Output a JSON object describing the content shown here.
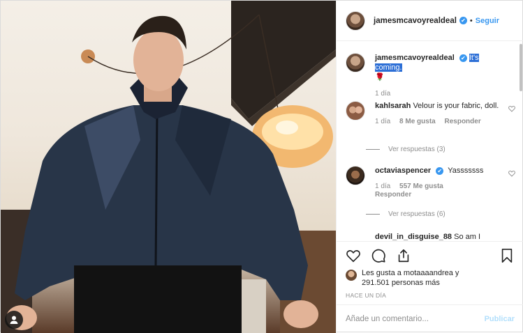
{
  "post": {
    "author": {
      "username": "jamesmcavoyrealdeal",
      "verified_icon": "✔",
      "separator": "•",
      "follow_label": "Seguir"
    },
    "caption": {
      "username": "jamesmcavoyrealdeal",
      "text": "It's coming.",
      "emoji": "🌹",
      "time": "1 día"
    },
    "comments": [
      {
        "username": "kahlsarah",
        "text": "Velour is your fabric, doll.",
        "time": "1 día",
        "likes": "8 Me gusta",
        "reply_label": "Responder",
        "view_replies": "Ver respuestas (3)"
      },
      {
        "username": "octaviaspencer",
        "text": "Yasssssss",
        "time": "1 día",
        "likes": "557 Me gusta",
        "reply_label": "Responder",
        "view_replies": "Ver respuestas (6)"
      },
      {
        "username": "devil_in_disguise_88",
        "text": "So am I"
      }
    ],
    "likes": {
      "line1": "Les gusta a motaaaandrea y",
      "line2": "291.501 personas más"
    },
    "timestamp": "HACE UN DÍA",
    "add_comment": {
      "placeholder": "Añade un comentario...",
      "publish_label": "Publicar"
    }
  },
  "colors": {
    "accent": "#3897f0",
    "muted": "#8e8e8e",
    "selection": "#2d6fd6",
    "publish_disabled": "#b2dffc"
  },
  "icons": [
    "user-tag-icon",
    "verified-icon",
    "heart-icon",
    "comment-icon",
    "share-icon",
    "bookmark-icon"
  ]
}
